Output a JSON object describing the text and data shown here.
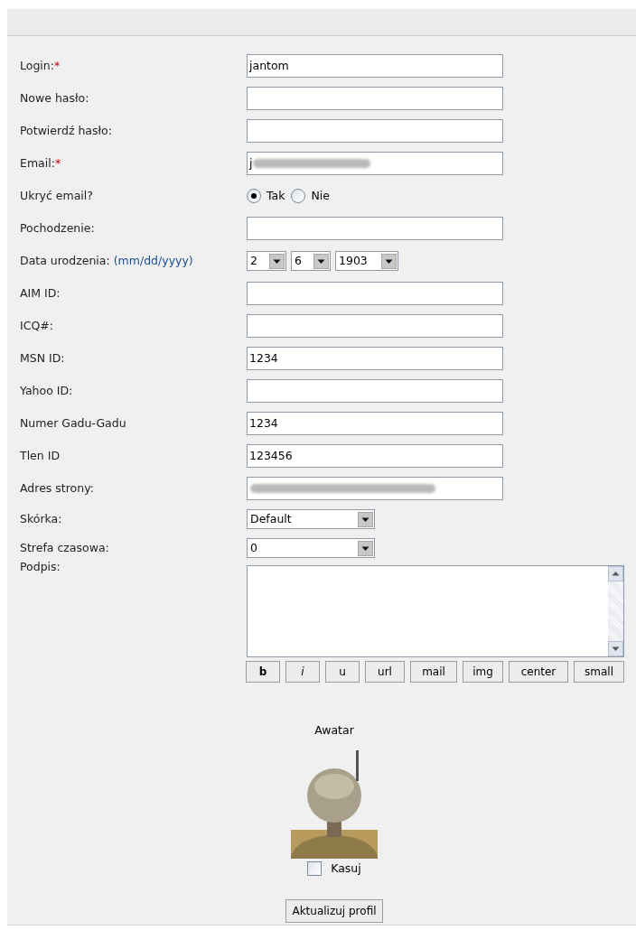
{
  "fields": [
    {
      "kind": "text",
      "label": "Login:",
      "required_mark": "*",
      "value": "jantom"
    },
    {
      "kind": "text",
      "label": "Nowe hasło:"
    },
    {
      "kind": "text",
      "label": "Potwierdź hasło:"
    },
    {
      "kind": "text",
      "label": "Email:",
      "required_mark": "*",
      "value": "j",
      "redacted": true
    },
    {
      "kind": "radio",
      "label": "Ukryć email?",
      "options": [
        {
          "label": "Tak",
          "selected": true
        },
        {
          "label": "Nie",
          "selected": false
        }
      ]
    },
    {
      "kind": "text",
      "label": "Pochodzenie:"
    },
    {
      "kind": "date",
      "label": "Data urodzenia:",
      "hint": "(mm/dd/yyyy)",
      "selects": [
        "2",
        "6",
        "1903"
      ]
    },
    {
      "kind": "text",
      "label": "AIM ID:"
    },
    {
      "kind": "text",
      "label": "ICQ#:"
    },
    {
      "kind": "text",
      "label": "MSN ID:",
      "value": "1234"
    },
    {
      "kind": "text",
      "label": "Yahoo ID:"
    },
    {
      "kind": "text",
      "label": "Numer Gadu-Gadu",
      "value": "1234"
    },
    {
      "kind": "text",
      "label": "Tlen ID",
      "value": "123456"
    },
    {
      "kind": "text",
      "label": "Adres strony:",
      "redacted": true
    },
    {
      "kind": "select",
      "label": "Skórka:",
      "value": "Default"
    },
    {
      "kind": "select",
      "label": "Strefa czasowa:",
      "value": "0"
    },
    {
      "kind": "textarea",
      "label": "Podpis:",
      "format_buttons": [
        "b",
        "i",
        "u",
        "url",
        "mail",
        "img",
        "center",
        "small"
      ]
    }
  ],
  "avatar": {
    "title": "Awatar",
    "delete": {
      "label": "Kasuj",
      "checked": false
    }
  },
  "submit": "Aktualizuj profil"
}
